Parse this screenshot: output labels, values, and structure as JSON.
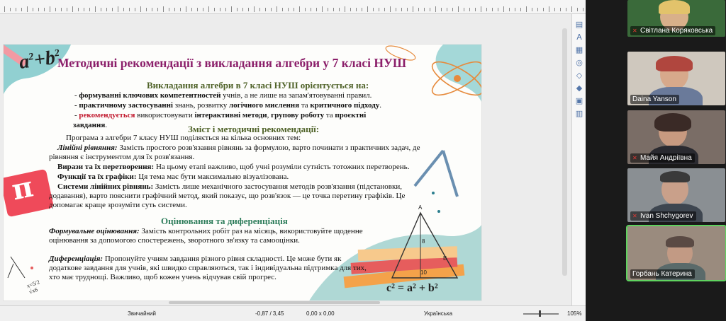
{
  "statusbar": {
    "style": "Звичайний",
    "position": "-0,87 / 3,45",
    "size": "0,00 x 0,00",
    "language": "Українська",
    "zoom": "105%"
  },
  "slide": {
    "title": "Методичні рекомендації з викладання алгебри у 7 класі НУШ",
    "section1": {
      "heading": "Викладання алгебри в 7 класі НУШ орієнтується на:",
      "b1_pre": "- ",
      "b1_bold": "формуванні ключових компетентностей",
      "b1_rest": " учнів, а не лише на запам'ятовуванні правил.",
      "b2_bold": "-  практичному застосуванні",
      "b2_rest1": " знань, розвитку ",
      "b2_bold2": "логічного мислення",
      "b2_rest2": " та ",
      "b2_bold3": "критичного підходу",
      "b2_end": ".",
      "b3_pre": "- ",
      "b3_red": "рекомендується",
      "b3_rest1": " використовувати ",
      "b3_bold1": "інтерактивні методи",
      "b3_rest2": ", ",
      "b3_bold2": "групову роботу",
      "b3_rest3": " та ",
      "b3_bold3": "проєктні",
      "b3_line2": "завдання",
      "b3_line2_end": "."
    },
    "section2": {
      "heading": "Зміст і методичні рекомендації:",
      "intro": "Програма з алгебри 7 класу НУШ поділяється на кілька основних тем:",
      "t1_label": "Лінійні рівняння:",
      "t1_text": " Замість простого розв'язання рівнянь за формулою, варто починати з практичних задач, де",
      "t1_text2": "рівняння є інструментом для їх розв'язання.",
      "t2_label": "Вирази та їх перетворення:",
      "t2_text": " На цьому етапі важливо, щоб учні розуміли сутність тотожних перетворень.",
      "t3_label": "Функції та їх графіки:",
      "t3_text": " Ця тема має бути максимально візуалізована.",
      "t4_label": "Системи лінійних рівнянь:",
      "t4_text": " Замість лише механічного застосування методів розв'язання (підстановки,",
      "t4_text2": "додавання), варто пояснити графічний метод, який показує, що розв'язок — це точка перетину графіків. Це",
      "t4_text3": "допомагає краще зрозуміти суть системи."
    },
    "section3": {
      "heading": "Оцінювання та диференціація",
      "f_label": "Формувальне оцінювання:",
      "f_text": " Замість контрольних робіт раз на місяць, використовуйте щоденне",
      "f_text2": "оцінювання за допомогою спостережень, зворотного зв'язку та самооцінки.",
      "d_label": "Диференціація:",
      "d_text": " Пропонуйте учням завдання різного рівня складності. Це може бути як",
      "d_text2": "додаткове завдання для учнів, які швидко справляються, так і індивідуальна підтримка для тих,",
      "d_text3": "хто має труднощі. Важливо, щоб кожен учень відчував свій прогрес."
    },
    "decor": {
      "formula_tl_a": "a",
      "formula_tl_plus": "+",
      "formula_tl_b": "b",
      "formula_tl_sup": "2",
      "pi": "π",
      "formula_br": "c² = a² + b²",
      "tri_a": "A",
      "tri_b": "B",
      "tri_h": "8",
      "tri_10": "10",
      "side_formula": "x=5/2\n√x6"
    }
  },
  "participants": [
    {
      "name": "Світлана Коряковська",
      "muted": true
    },
    {
      "name": "Daina Yanson",
      "muted": false
    },
    {
      "name": "Майя Андріївна",
      "muted": true
    },
    {
      "name": "Ivan Shchygorev",
      "muted": true
    },
    {
      "name": "Горбань Катерина",
      "muted": false,
      "active": true
    }
  ],
  "colors": {
    "title": "#8b1f6a",
    "heading_green": "#4f6228",
    "heading_teal": "#2e7d5b",
    "emphasis_red": "#c0152a",
    "active_speaker": "#5fd35f"
  }
}
